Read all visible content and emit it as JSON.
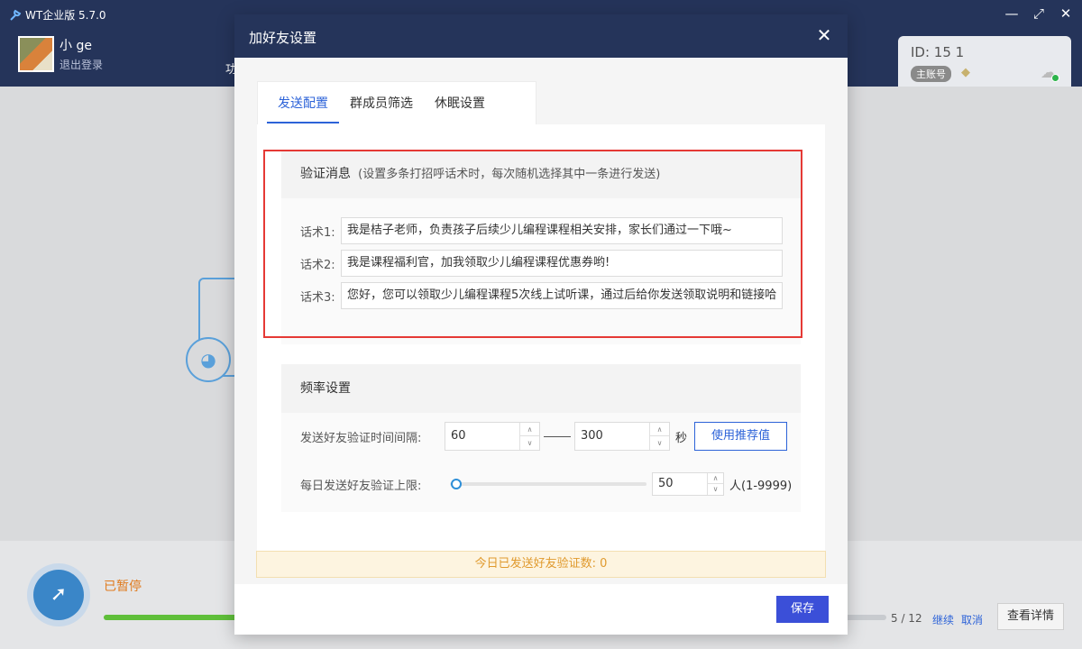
{
  "app": {
    "title": "WT企业版 5.7.0",
    "user_name": "小          ge",
    "logout": "退出登录",
    "nav_hint": "功",
    "id_text": "ID: 15        1",
    "main_badge": "主账号",
    "window_controls": {
      "minimize": "—",
      "maximize": "⤢",
      "close": "✕"
    }
  },
  "task": {
    "status": "已暂停",
    "progress": {
      "done": 5,
      "total": 12,
      "label": "5 / 12"
    },
    "continue": "继续",
    "cancel": "取消",
    "details": "查看详情"
  },
  "dialog": {
    "title": "加好友设置",
    "tabs": [
      {
        "label": "发送配置",
        "active": true
      },
      {
        "label": "群成员筛选",
        "active": false
      },
      {
        "label": "休眠设置",
        "active": false
      }
    ],
    "verify": {
      "title": "验证消息",
      "subtitle": "(设置多条打招呼话术时，每次随机选择其中一条进行发送)",
      "scripts": [
        {
          "label": "话术1:",
          "value": "我是桔子老师，负责孩子后续少儿编程课程相关安排，家长们通过一下哦~"
        },
        {
          "label": "话术2:",
          "value": "我是课程福利官，加我领取少儿编程课程优惠券哟!"
        },
        {
          "label": "话术3:",
          "value": "您好，您可以领取少儿编程课程5次线上试听课，通过后给你发送领取说明和链接哈"
        }
      ]
    },
    "frequency": {
      "title": "频率设置",
      "interval_label": "发送好友验证时间间隔:",
      "interval_min": "60",
      "interval_max": "300",
      "interval_unit": "秒",
      "recommend_button": "使用推荐值",
      "daily_label": "每日发送好友验证上限:",
      "daily_value": "50",
      "daily_unit": "人(1-9999)",
      "daily_slider_fraction": 0.005
    },
    "sent_today": "今日已发送好友验证数:  0",
    "save": "保存"
  },
  "colors": {
    "header": "#25345a",
    "accent": "#2d63d8",
    "save_button": "#3b4fd8",
    "highlight_frame": "#e53935",
    "paused": "#e07a1d",
    "progress": "#5fbf3a"
  }
}
